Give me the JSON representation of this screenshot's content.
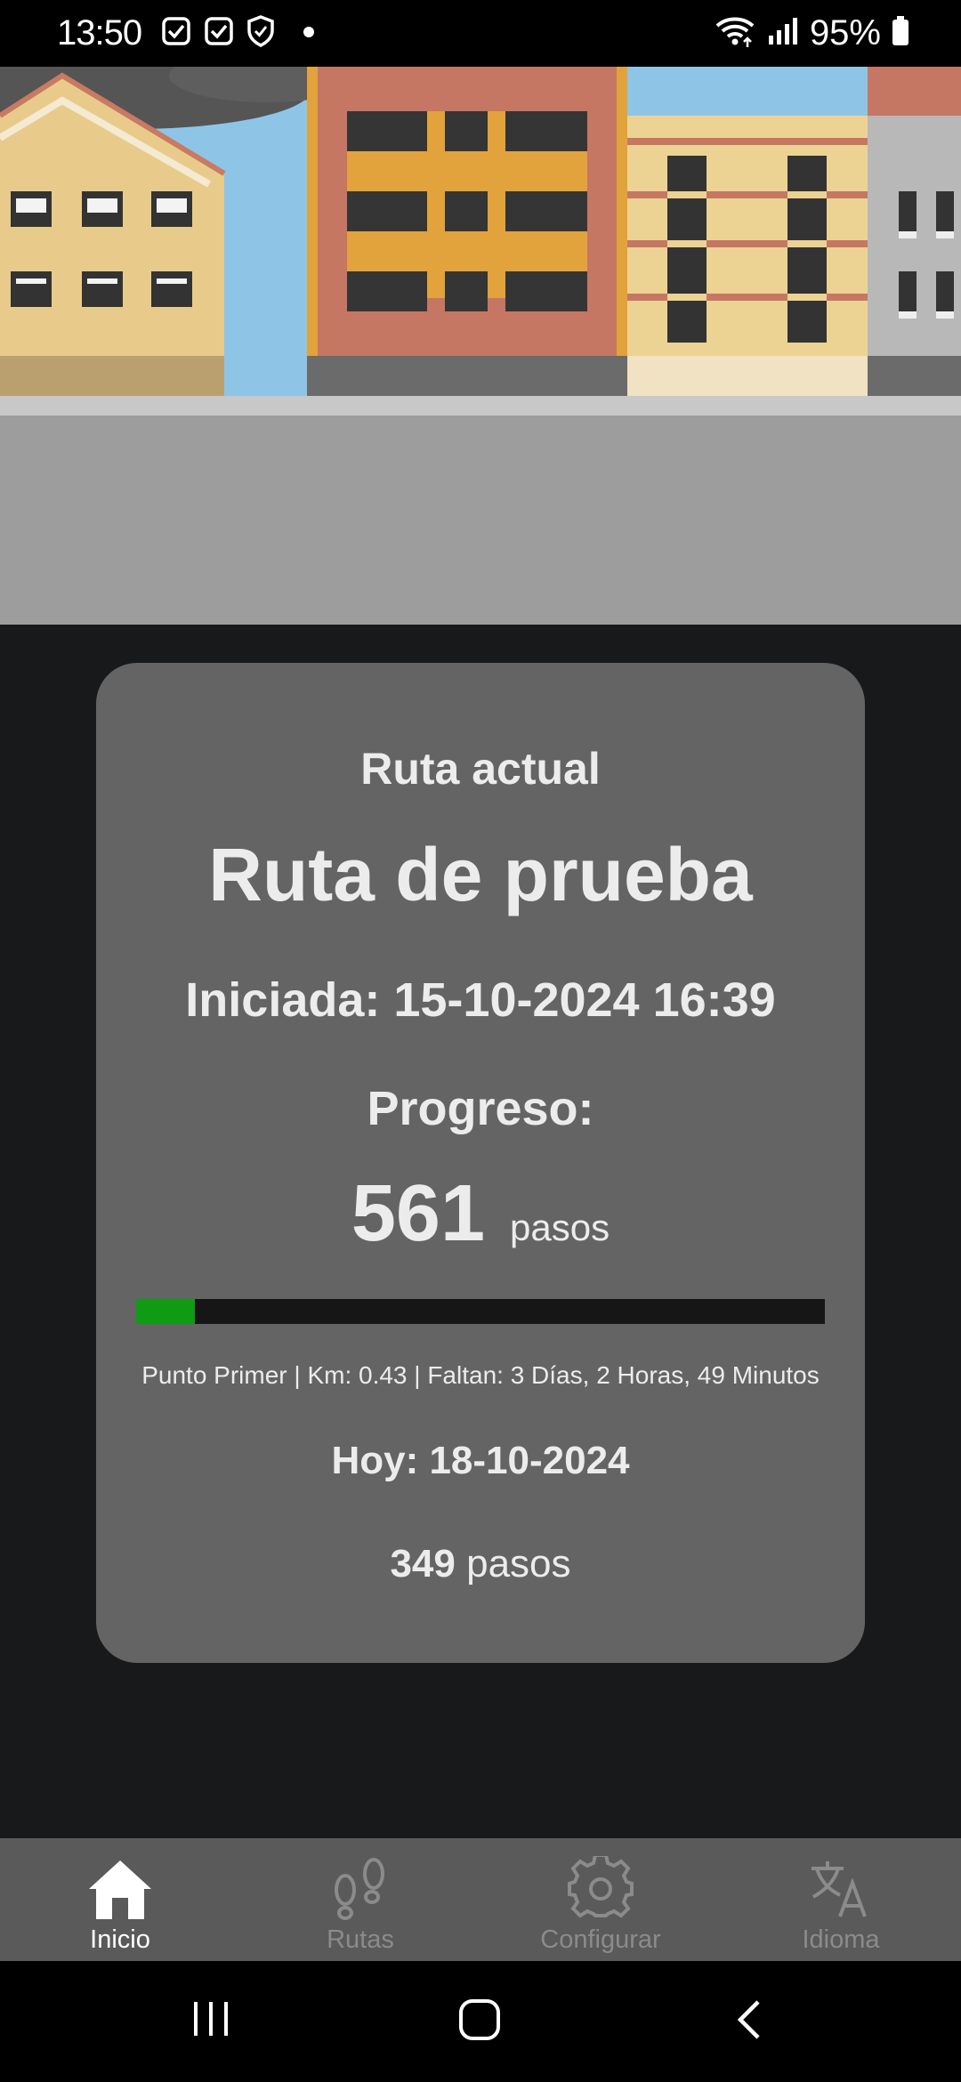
{
  "status_bar": {
    "time": "13:50",
    "battery": "95%",
    "icons": [
      "check-square-icon",
      "check-square-icon",
      "shield-check-icon",
      "dot-icon",
      "wifi-icon",
      "signal-icon",
      "battery-icon"
    ]
  },
  "card": {
    "route_label": "Ruta actual",
    "route_name": "Ruta de prueba",
    "started": "Iniciada: 15-10-2024 16:39",
    "progress_label": "Progreso:",
    "progress_steps": "561",
    "steps_unit": "pasos",
    "progress_fraction": 0.085,
    "progress_detail": "Punto Primer | Km: 0.43 | Faltan: 3 Días, 2 Horas, 49 Minutos",
    "today": "Hoy: 18-10-2024",
    "today_steps": "349",
    "today_steps_unit": "pasos"
  },
  "bottom_nav": {
    "items": [
      {
        "label": "Inicio",
        "icon": "home-icon",
        "active": true
      },
      {
        "label": "Rutas",
        "icon": "footsteps-icon",
        "active": false
      },
      {
        "label": "Configurar",
        "icon": "gear-icon",
        "active": false
      },
      {
        "label": "Idioma",
        "icon": "translate-icon",
        "active": false
      }
    ]
  },
  "colors": {
    "card_bg": "#646464",
    "progress_fill": "#0f9b14",
    "progress_track": "#161616",
    "nav_bg": "#5a5a5a",
    "page_bg": "#18191b"
  }
}
